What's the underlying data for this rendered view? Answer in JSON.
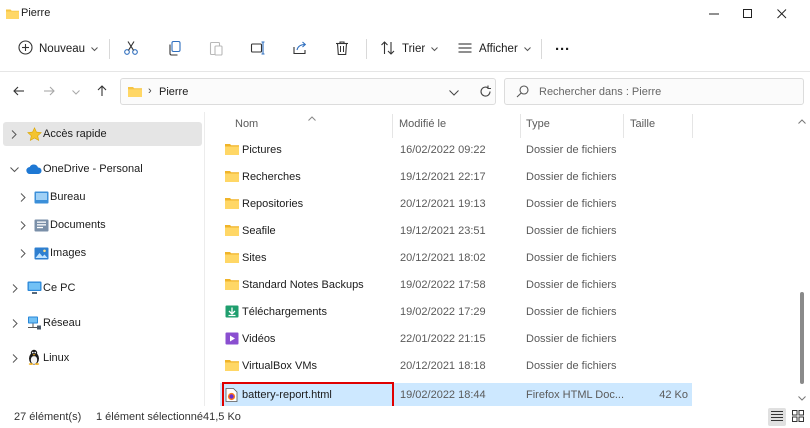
{
  "window": {
    "title": "Pierre"
  },
  "toolbar": {
    "new_label": "Nouveau",
    "sort_label": "Trier",
    "view_label": "Afficher",
    "more_label": "···"
  },
  "address": {
    "separator": "›",
    "crumb": "Pierre"
  },
  "search": {
    "placeholder": "Rechercher dans : Pierre"
  },
  "sidebar": {
    "items": [
      {
        "label": "Accès rapide"
      },
      {
        "label": "OneDrive - Personal"
      },
      {
        "label": "Bureau"
      },
      {
        "label": "Documents"
      },
      {
        "label": "Images"
      },
      {
        "label": "Ce PC"
      },
      {
        "label": "Réseau"
      },
      {
        "label": "Linux"
      }
    ]
  },
  "columns": {
    "name": "Nom",
    "modified": "Modifié le",
    "type": "Type",
    "size": "Taille"
  },
  "files": [
    {
      "name": "Pictures",
      "date": "16/02/2022 09:22",
      "type": "Dossier de fichiers",
      "size": ""
    },
    {
      "name": "Recherches",
      "date": "19/12/2021 22:17",
      "type": "Dossier de fichiers",
      "size": ""
    },
    {
      "name": "Repositories",
      "date": "20/12/2021 19:13",
      "type": "Dossier de fichiers",
      "size": ""
    },
    {
      "name": "Seafile",
      "date": "19/12/2021 23:51",
      "type": "Dossier de fichiers",
      "size": ""
    },
    {
      "name": "Sites",
      "date": "20/12/2021 18:02",
      "type": "Dossier de fichiers",
      "size": ""
    },
    {
      "name": "Standard Notes Backups",
      "date": "19/02/2022 17:58",
      "type": "Dossier de fichiers",
      "size": ""
    },
    {
      "name": "Téléchargements",
      "date": "19/02/2022 17:29",
      "type": "Dossier de fichiers",
      "size": ""
    },
    {
      "name": "Vidéos",
      "date": "22/01/2022 21:15",
      "type": "Dossier de fichiers",
      "size": ""
    },
    {
      "name": "VirtualBox VMs",
      "date": "20/12/2021 18:18",
      "type": "Dossier de fichiers",
      "size": ""
    },
    {
      "name": "battery-report.html",
      "date": "19/02/2022 18:44",
      "type": "Firefox HTML Doc...",
      "size": "42 Ko"
    }
  ],
  "status": {
    "count": "27 élément(s)",
    "selection": "1 élément sélectionné",
    "selection_size": "41,5 Ko"
  },
  "colors": {
    "folder": "#f6c443",
    "selection": "#cde8ff",
    "highlight": "#e00000"
  }
}
